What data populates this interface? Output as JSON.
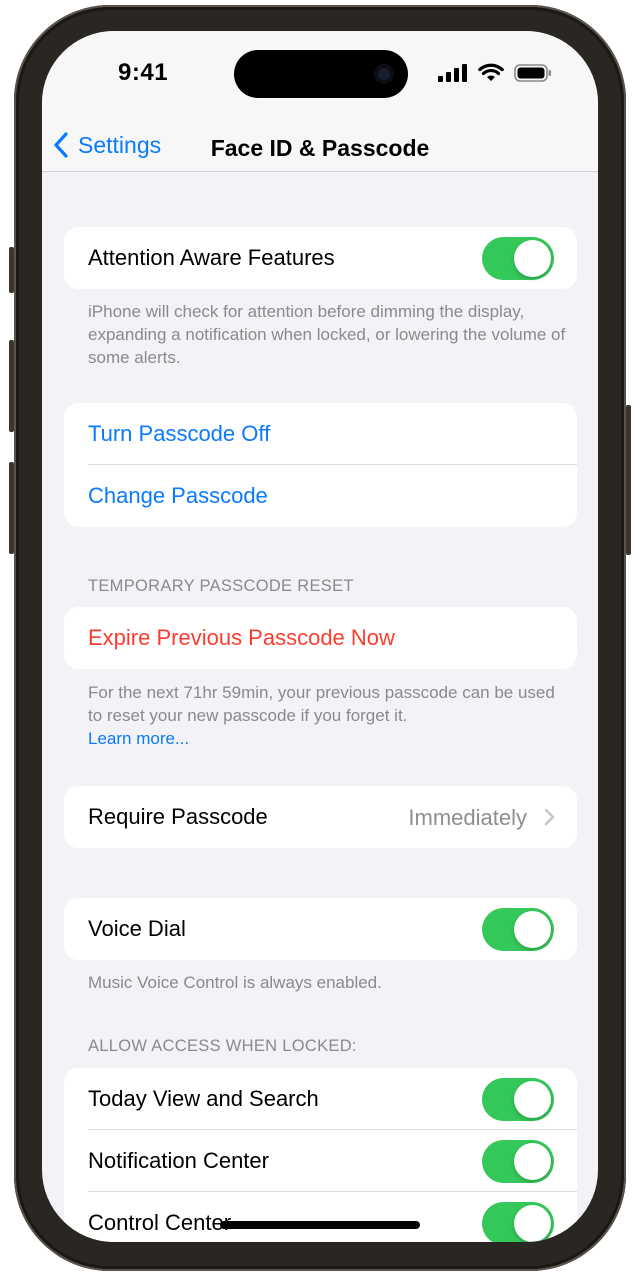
{
  "status_bar": {
    "time": "9:41"
  },
  "nav": {
    "back_label": "Settings",
    "title": "Face ID & Passcode"
  },
  "attention": {
    "label": "Attention Aware Features",
    "enabled": true,
    "footer": "iPhone will check for attention before dimming the display, expanding a notification when locked, or lowering the volume of some alerts."
  },
  "passcode_actions": {
    "turn_off": "Turn Passcode Off",
    "change": "Change Passcode"
  },
  "temp_reset": {
    "header": "TEMPORARY PASSCODE RESET",
    "expire_label": "Expire Previous Passcode Now",
    "footer": "For the next 71hr 59min, your previous passcode can be used to reset your new passcode if you forget it.",
    "learn_more": "Learn more..."
  },
  "require_passcode": {
    "label": "Require Passcode",
    "value": "Immediately"
  },
  "voice_dial": {
    "label": "Voice Dial",
    "enabled": true,
    "footer": "Music Voice Control is always enabled."
  },
  "locked_access": {
    "header": "ALLOW ACCESS WHEN LOCKED:",
    "items": [
      {
        "label": "Today View and Search",
        "enabled": true
      },
      {
        "label": "Notification Center",
        "enabled": true
      },
      {
        "label": "Control Center",
        "enabled": true
      }
    ]
  },
  "colors": {
    "accent": "#0a7aff",
    "destructive": "#ff3b30",
    "toggle_on": "#34c759",
    "background": "#f2f2f7"
  }
}
